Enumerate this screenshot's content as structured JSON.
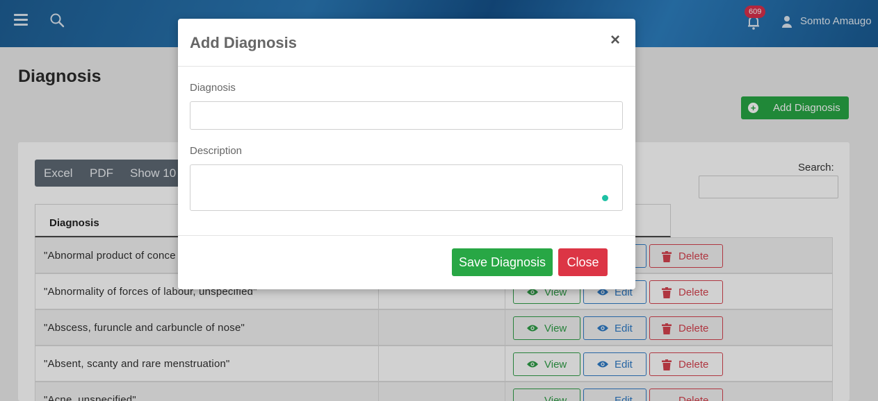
{
  "navbar": {
    "notification_count": "609",
    "user_name": "Somto Amaugo"
  },
  "page": {
    "title": "Diagnosis",
    "add_button_label": "Add Diagnosis"
  },
  "toolbar": {
    "excel_label": "Excel",
    "pdf_label": "PDF",
    "show_label": "Show 10",
    "search_label": "Search:"
  },
  "table": {
    "header": "Diagnosis",
    "rows": [
      {
        "name": "\"Abnormal product of conce"
      },
      {
        "name": "\"Abnormality of forces of labour, unspecified\""
      },
      {
        "name": "\"Abscess, furuncle and carbuncle of nose\""
      },
      {
        "name": "\"Absent, scanty and rare menstruation\""
      },
      {
        "name": "\"Acne, unspecified\""
      }
    ],
    "view_label": "View",
    "edit_label": "Edit",
    "delete_label": "Delete"
  },
  "modal": {
    "title": "Add Diagnosis",
    "close_symbol": "×",
    "diagnosis_label": "Diagnosis",
    "diagnosis_value": "",
    "description_label": "Description",
    "description_value": "",
    "save_label": "Save Diagnosis",
    "close_label": "Close"
  },
  "colors": {
    "navbar": "#1e5f95",
    "success": "#28a745",
    "danger": "#dc3545",
    "primary": "#2f7cc7"
  }
}
